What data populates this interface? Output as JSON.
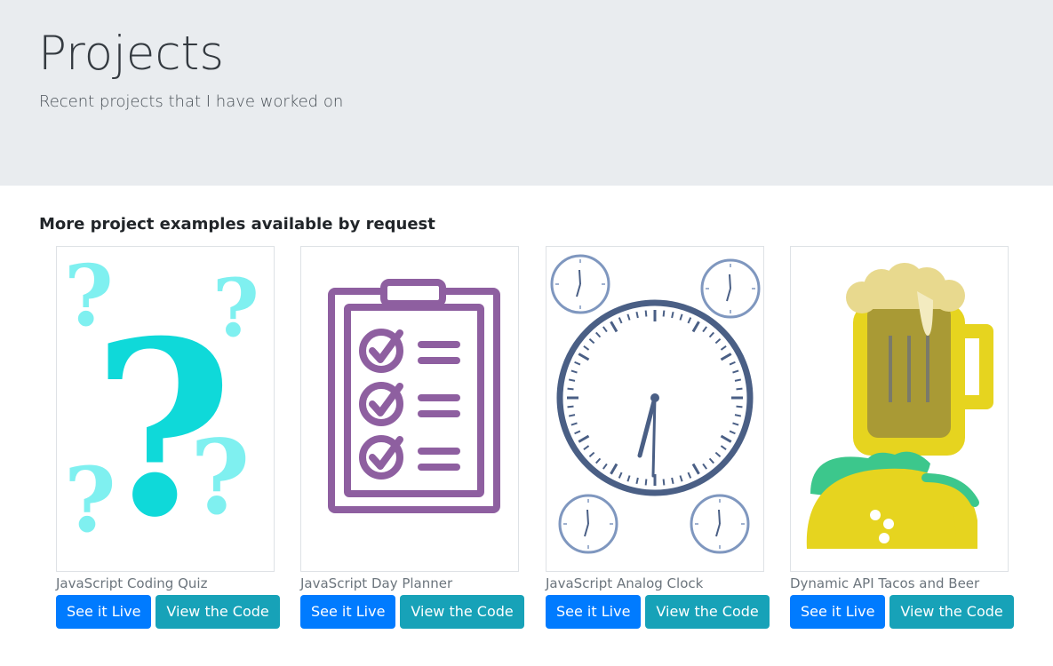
{
  "header": {
    "title": "Projects",
    "subtitle": "Recent projects that I have worked on"
  },
  "section_title": "More project examples available by request",
  "projects": [
    {
      "caption": "JavaScript Coding Quiz",
      "live_label": "See it Live",
      "code_label": "View the Code",
      "image_icon": "question-marks-icon"
    },
    {
      "caption": "JavaScript Day Planner",
      "live_label": "See it Live",
      "code_label": "View the Code",
      "image_icon": "checklist-clipboard-icon"
    },
    {
      "caption": "JavaScript Analog Clock",
      "live_label": "See it Live",
      "code_label": "View the Code",
      "image_icon": "analog-clock-icon"
    },
    {
      "caption": "Dynamic API Tacos and Beer",
      "live_label": "See it Live",
      "code_label": "View the Code",
      "image_icon": "taco-beer-icon"
    }
  ],
  "colors": {
    "jumbotron_bg": "#e9ecef",
    "primary_button": "#007bff",
    "info_button": "#17a2b8",
    "quiz_teal": "#0fd9d9",
    "planner_purple": "#8e5fa0",
    "clock_navy": "#4a5f85",
    "beer_yellow": "#e6d41f",
    "taco_green": "#3cc78c"
  }
}
